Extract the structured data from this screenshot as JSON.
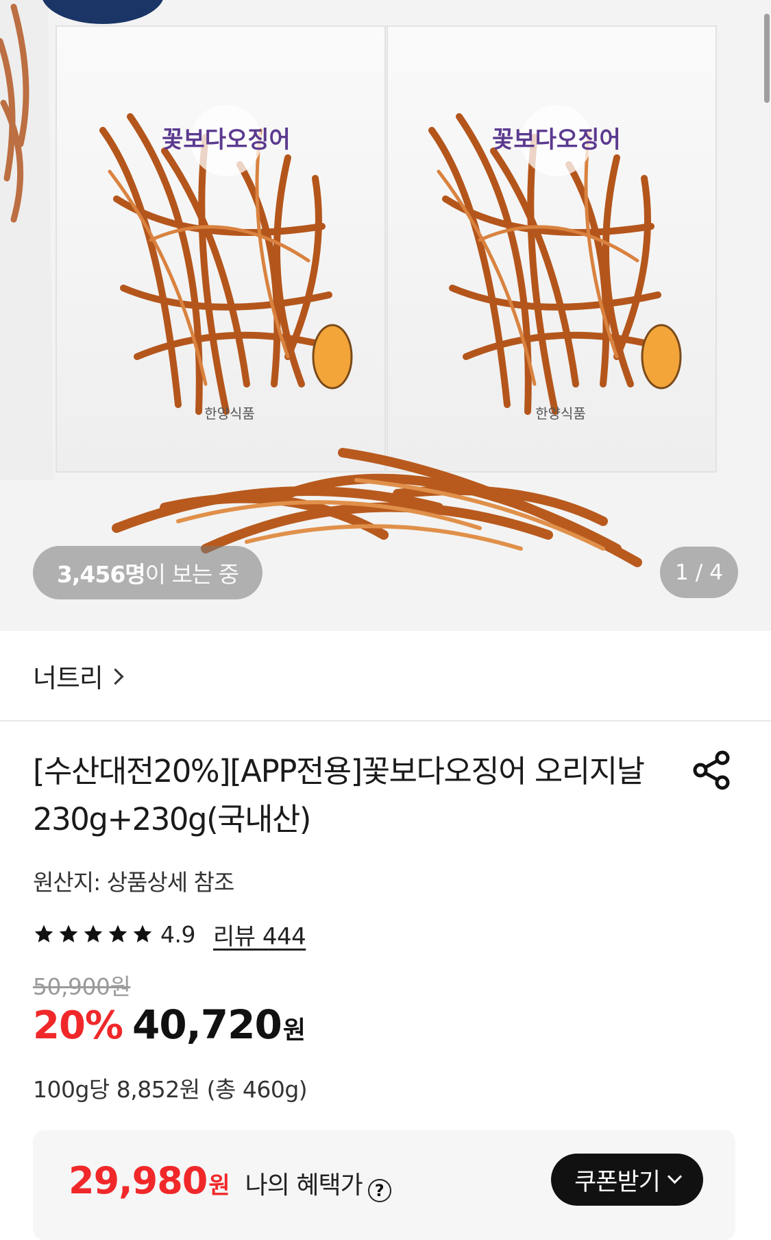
{
  "gallery": {
    "viewers_count": "3,456명",
    "viewers_suffix": "이 보는 중",
    "page_current": "1",
    "page_separator": "/",
    "page_total": "4",
    "brand_logo_text": "꽃보다오징어",
    "manufacturer_text": "한양식품"
  },
  "seller": {
    "name": "너트리"
  },
  "product": {
    "title": "[수산대전20%][APP전용]꽃보다오징어 오리지날 230g+230g(국내산)",
    "origin": "원산지: 상품상세 참조",
    "rating": "4.9",
    "rating_stars": 5,
    "review_link": "리뷰 444",
    "original_price": "50,900원",
    "discount": "20%",
    "sale_price": "40,720",
    "currency": "원",
    "unit_price": "100g당 8,852원 (총 460g)"
  },
  "benefit": {
    "price": "29,980",
    "currency": "원",
    "label": "나의 혜택가",
    "help": "?",
    "coupon_button": "쿠폰받기"
  },
  "colors": {
    "accent_red": "#f0282a",
    "coupon_bg": "#111111",
    "star": "#111111"
  }
}
